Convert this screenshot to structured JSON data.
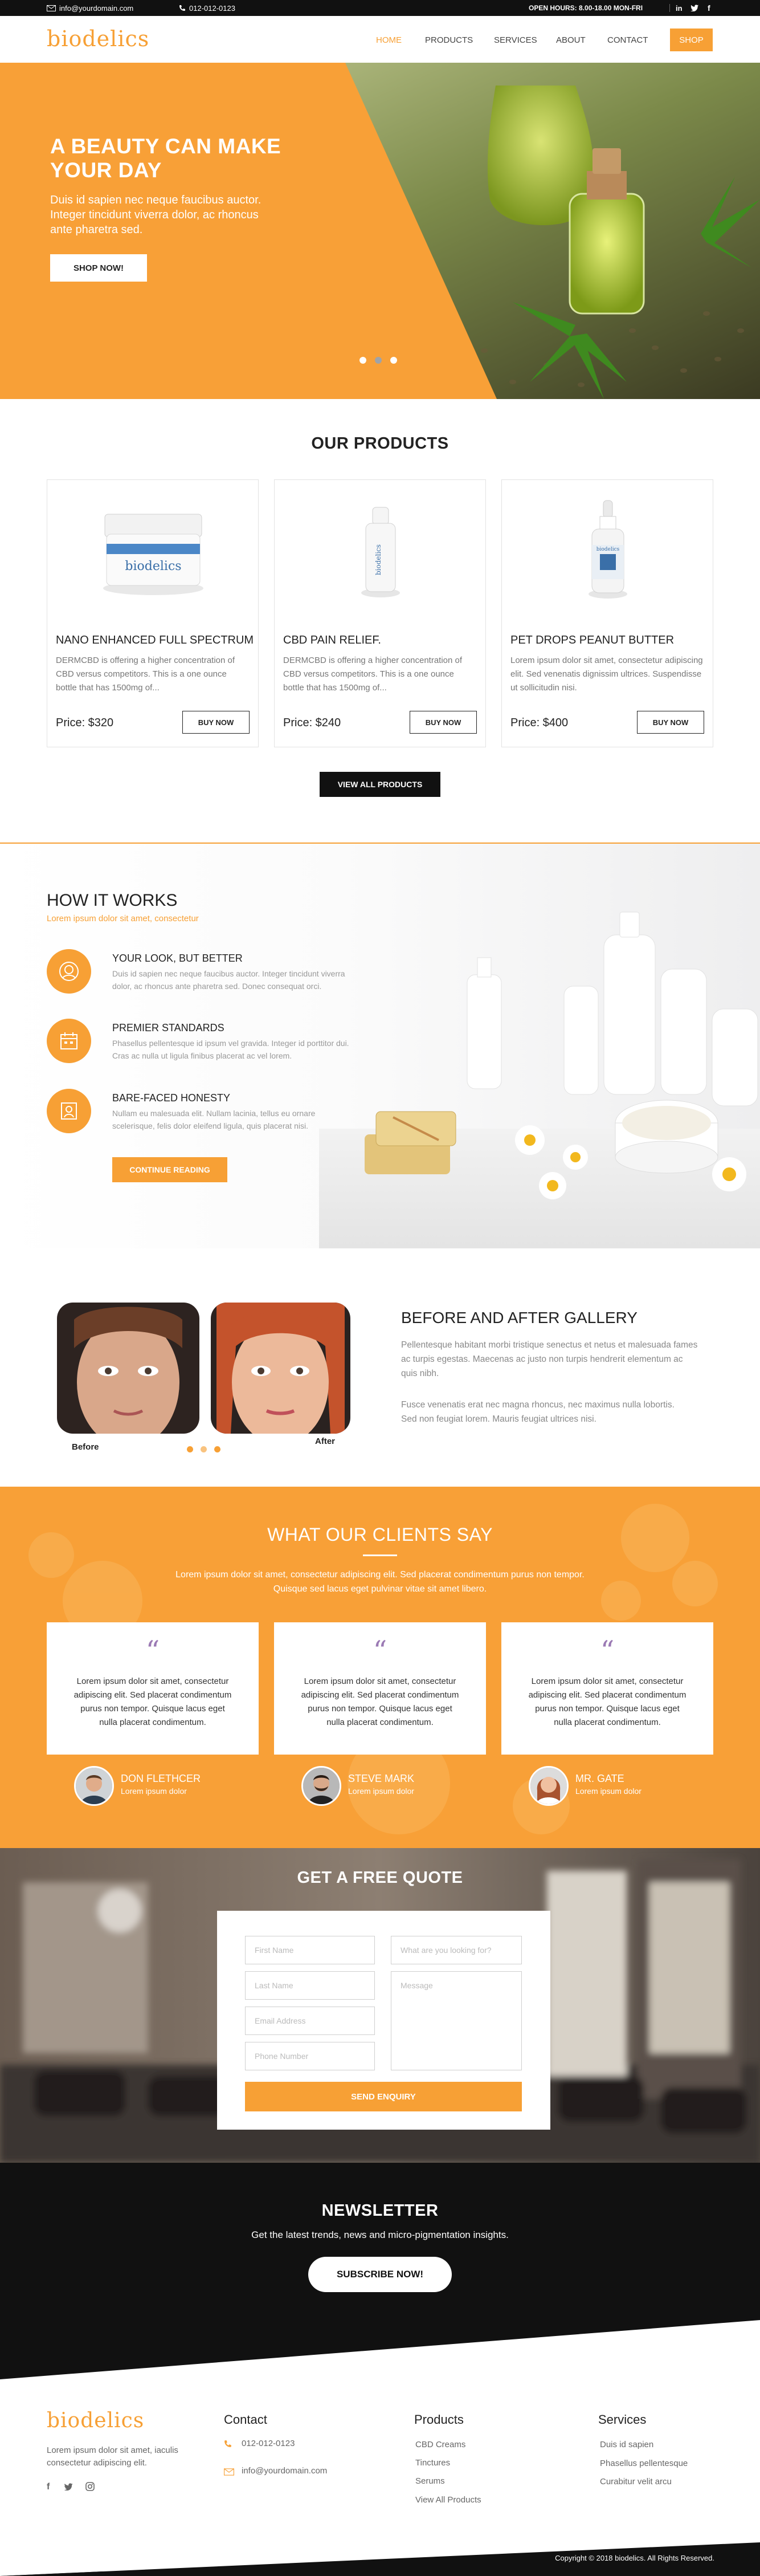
{
  "topbar": {
    "email": "info@yourdomain.com",
    "phone": "012-012-0123",
    "hours": "OPEN HOURS: 8.00-18.00 MON-FRI"
  },
  "nav": {
    "logo": "biodelics",
    "links": [
      "HOME",
      "PRODUCTS",
      "SERVICES",
      "ABOUT",
      "CONTACT"
    ],
    "active": "HOME",
    "shop": "SHOP"
  },
  "hero": {
    "title_line1": "A BEAUTY CAN MAKE",
    "title_line2": "YOUR DAY",
    "text_line1": "Duis id sapien nec neque faucibus auctor.",
    "text_line2": "Integer tincidunt viverra dolor, ac rhoncus",
    "text_line3": "ante pharetra sed.",
    "cta": "SHOP NOW!",
    "slide_count": 3,
    "active_slide": 2
  },
  "products": {
    "title": "OUR PRODUCTS",
    "items": [
      {
        "name": "NANO ENHANCED FULL SPECTRUM",
        "desc": "DERMCBD is offering a higher concentration of CBD versus competitors. This is a one ounce bottle that has 1500mg of...",
        "price": "Price: $320",
        "buy": "BUY NOW",
        "jar_label": "biodelics"
      },
      {
        "name": "CBD PAIN RELIEF.",
        "desc": "DERMCBD is offering a higher concentration of CBD versus competitors. This is a one ounce bottle that has 1500mg of...",
        "price": "Price: $240",
        "buy": "BUY NOW",
        "jar_label": "biodelics"
      },
      {
        "name": "PET DROPS PEANUT BUTTER",
        "desc": "Lorem ipsum dolor sit amet, consectetur adipiscing elit. Sed venenatis dignissim ultrices. Suspendisse ut sollicitudin nisi.",
        "price": "Price: $400",
        "buy": "BUY NOW",
        "jar_label": "biodelics"
      }
    ],
    "view_all": "VIEW ALL PRODUCTS"
  },
  "how": {
    "title": "HOW IT WORKS",
    "subtitle": "Lorem ipsum dolor sit amet, consectetur",
    "items": [
      {
        "title": "YOUR LOOK, BUT BETTER",
        "line1": "Duis id sapien nec neque faucibus auctor. Integer tincidunt viverra",
        "line2": "dolor, ac rhoncus ante pharetra sed. Donec consequat orci.",
        "icon": "face-icon"
      },
      {
        "title": "PREMIER STANDARDS",
        "line1": "Phasellus pellentesque id ipsum vel gravida. Integer id porttitor dui.",
        "line2": "Cras ac nulla ut ligula finibus placerat ac vel lorem.",
        "icon": "calendar-icon"
      },
      {
        "title": "BARE-FACED HONESTY",
        "line1": "Nullam eu malesuada elit. Nullam lacinia, tellus eu ornare",
        "line2": "scelerisque, felis dolor eleifend ligula, quis placerat nisi.",
        "icon": "portrait-icon"
      }
    ],
    "cta": "CONTINUE READING"
  },
  "gallery": {
    "before_label": "Before",
    "after_label": "After",
    "title": "BEFORE AND AFTER GALLERY",
    "p1_line1": "Pellentesque habitant morbi tristique senectus et netus et malesuada fames",
    "p1_line2": "ac turpis egestas. Maecenas ac justo non turpis hendrerit elementum ac",
    "p1_line3": "quis nibh.",
    "p2_line1": "Fusce venenatis erat nec magna rhoncus, nec maximus nulla lobortis.",
    "p2_line2": "Sed non feugiat lorem. Mauris feugiat ultrices nisi."
  },
  "testimonials": {
    "title": "WHAT OUR CLIENTS SAY",
    "sub1": "Lorem ipsum dolor sit amet, consectetur adipiscing elit. Sed placerat condimentum purus non tempor.",
    "sub2": "Quisque sed lacus eget  pulvinar vitae sit amet libero.",
    "quote_mark": "“",
    "cards": [
      {
        "l1": "Lorem ipsum dolor sit amet, consectetur",
        "l2": "adipiscing elit. Sed placerat condimentum",
        "l3": "purus non tempor. Quisque lacus eget",
        "l4": "nulla placerat condimentum.",
        "name": "DON FLETHCER",
        "role": "Lorem ipsum dolor"
      },
      {
        "l1": "Lorem ipsum dolor sit amet, consectetur",
        "l2": "adipiscing elit. Sed placerat condimentum",
        "l3": "purus non tempor. Quisque lacus eget",
        "l4": "nulla placerat condimentum.",
        "name": "STEVE MARK",
        "role": "Lorem ipsum dolor"
      },
      {
        "l1": "Lorem ipsum dolor sit amet, consectetur",
        "l2": "adipiscing elit. Sed placerat condimentum",
        "l3": "purus non tempor. Quisque lacus eget",
        "l4": "nulla placerat condimentum.",
        "name": "MR. GATE",
        "role": "Lorem ipsum dolor"
      }
    ]
  },
  "quote": {
    "title": "GET A FREE QUOTE",
    "first_name": "First Name",
    "last_name": "Last Name",
    "email": "Email Address",
    "phone": "Phone Number",
    "looking_for": "What are you looking for?",
    "message": "Message",
    "submit": "SEND ENQUIRY"
  },
  "newsletter": {
    "title": "NEWSLETTER",
    "text": "Get the latest trends, news and micro-pigmentation insights.",
    "cta": "SUBSCRIBE NOW!"
  },
  "footer": {
    "logo": "biodelics",
    "about_line1": "Lorem ipsum dolor sit amet, iaculis",
    "about_line2": "consectetur adipiscing elit.",
    "contact_title": "Contact",
    "contact_phone": "012-012-0123",
    "contact_email": "info@yourdomain.com",
    "products_title": "Products",
    "products_links": [
      "CBD Creams",
      "Tinctures",
      "Serums",
      "View All Products"
    ],
    "services_title": "Services",
    "services_links": [
      "Duis id sapien",
      "Phasellus pellentesque",
      "Curabitur velit arcu"
    ],
    "copyright": "Copyright © 2018 biodelics. All Rights Reserved."
  },
  "colors": {
    "accent": "#f7a035",
    "dark": "#111111",
    "quote_purple": "#9b7ab4"
  }
}
